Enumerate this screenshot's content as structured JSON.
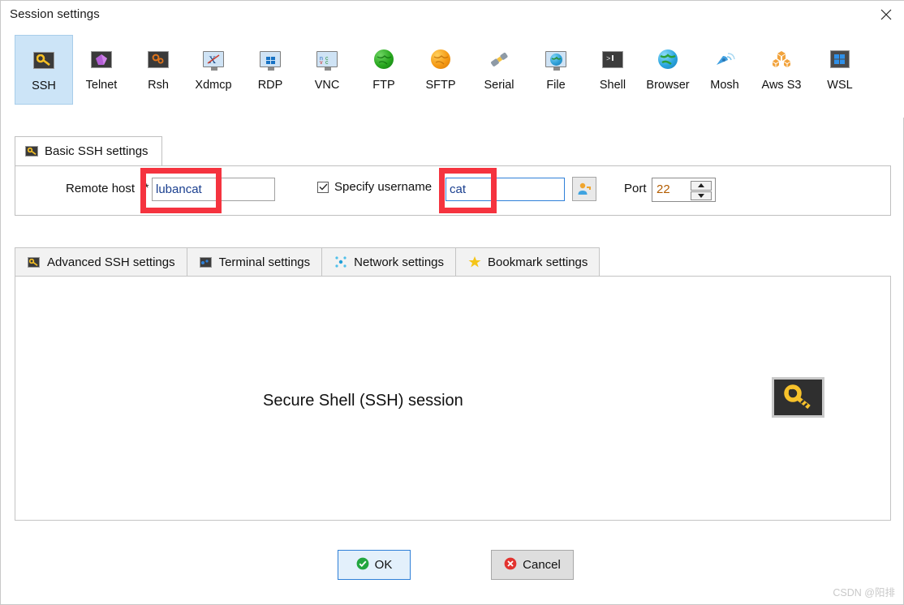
{
  "window": {
    "title": "Session settings",
    "close_icon": "close-icon"
  },
  "session_types": [
    {
      "label": "SSH",
      "icon": "key-icon",
      "selected": true
    },
    {
      "label": "Telnet",
      "icon": "crystal-icon",
      "selected": false
    },
    {
      "label": "Rsh",
      "icon": "gears-icon",
      "selected": false
    },
    {
      "label": "Xdmcp",
      "icon": "x-monitor-icon",
      "selected": false
    },
    {
      "label": "RDP",
      "icon": "windows-monitor-icon",
      "selected": false
    },
    {
      "label": "VNC",
      "icon": "vnc-monitor-icon",
      "selected": false
    },
    {
      "label": "FTP",
      "icon": "green-globe-icon",
      "selected": false
    },
    {
      "label": "SFTP",
      "icon": "orange-globe-icon",
      "selected": false
    },
    {
      "label": "Serial",
      "icon": "serial-plug-icon",
      "selected": false
    },
    {
      "label": "File",
      "icon": "file-monitor-icon",
      "selected": false
    },
    {
      "label": "Shell",
      "icon": "terminal-icon",
      "selected": false
    },
    {
      "label": "Browser",
      "icon": "blue-globe-icon",
      "selected": false
    },
    {
      "label": "Mosh",
      "icon": "satellite-icon",
      "selected": false
    },
    {
      "label": "Aws S3",
      "icon": "aws-cubes-icon",
      "selected": false
    },
    {
      "label": "WSL",
      "icon": "wsl-windows-icon",
      "selected": false
    }
  ],
  "basic_tab": {
    "label": "Basic SSH settings",
    "icon": "key-icon"
  },
  "form": {
    "remote_host_label": "Remote host",
    "required_marker": "*",
    "remote_host_value": "lubancat",
    "remote_host_placeholder": "",
    "specify_username_label": "Specify username",
    "specify_username_checked": true,
    "username_value": "cat",
    "username_placeholder": "",
    "user_picker_icon": "user-key-icon",
    "port_label": "Port",
    "port_value": "22",
    "spinner_up_icon": "chevron-up-icon",
    "spinner_down_icon": "chevron-down-icon"
  },
  "sub_tabs": [
    {
      "label": "Advanced SSH settings",
      "icon": "key-icon",
      "active": false
    },
    {
      "label": "Terminal settings",
      "icon": "terminal-blue-icon",
      "active": false
    },
    {
      "label": "Network settings",
      "icon": "network-nodes-icon",
      "active": false
    },
    {
      "label": "Bookmark settings",
      "icon": "star-icon",
      "active": false
    }
  ],
  "content": {
    "title": "Secure Shell (SSH) session",
    "badge_icon": "big-key-icon"
  },
  "footer": {
    "ok_label": "OK",
    "ok_icon": "green-check-icon",
    "cancel_label": "Cancel",
    "cancel_icon": "red-x-icon"
  },
  "annotations": [
    {
      "name": "remote-host-highlight",
      "color": "#f5333f"
    },
    {
      "name": "username-highlight",
      "color": "#f5333f"
    }
  ],
  "watermark": "CSDN @阳排"
}
